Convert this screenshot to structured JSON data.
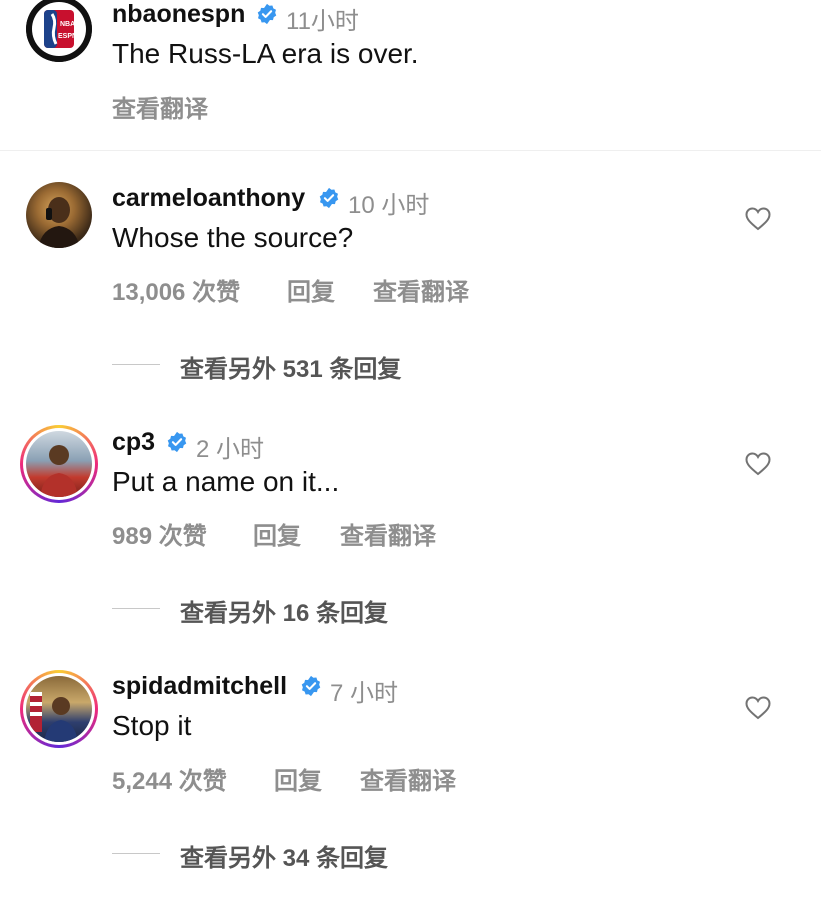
{
  "post": {
    "username": "nbaonespn",
    "time": "11小时",
    "caption": "The Russ-LA era is over.",
    "translate": "查看翻译",
    "avatar_logo_text": "NBA ESPN"
  },
  "comments": [
    {
      "username": "carmeloanthony",
      "time": "10 小时",
      "text": "Whose the source?",
      "likes": "13,006 次赞",
      "reply": "回复",
      "translate": "查看翻译",
      "view_replies": "查看另外 531 条回复"
    },
    {
      "username": "cp3",
      "time": "2 小时",
      "text": "Put a name on it...",
      "likes": "989 次赞",
      "reply": "回复",
      "translate": "查看翻译",
      "view_replies": "查看另外 16 条回复"
    },
    {
      "username": "spidadmitchell",
      "time": "7 小时",
      "text": "Stop it",
      "likes": "5,244 次赞",
      "reply": "回复",
      "translate": "查看翻译",
      "view_replies": "查看另外 34 条回复"
    }
  ],
  "colors": {
    "verified": "#3897f0",
    "muted": "#8e8e8e",
    "story_ring": [
      "#f9ce34",
      "#ee2a7b",
      "#6228d7"
    ]
  },
  "icons": [
    "verified-badge-icon",
    "heart-icon"
  ]
}
